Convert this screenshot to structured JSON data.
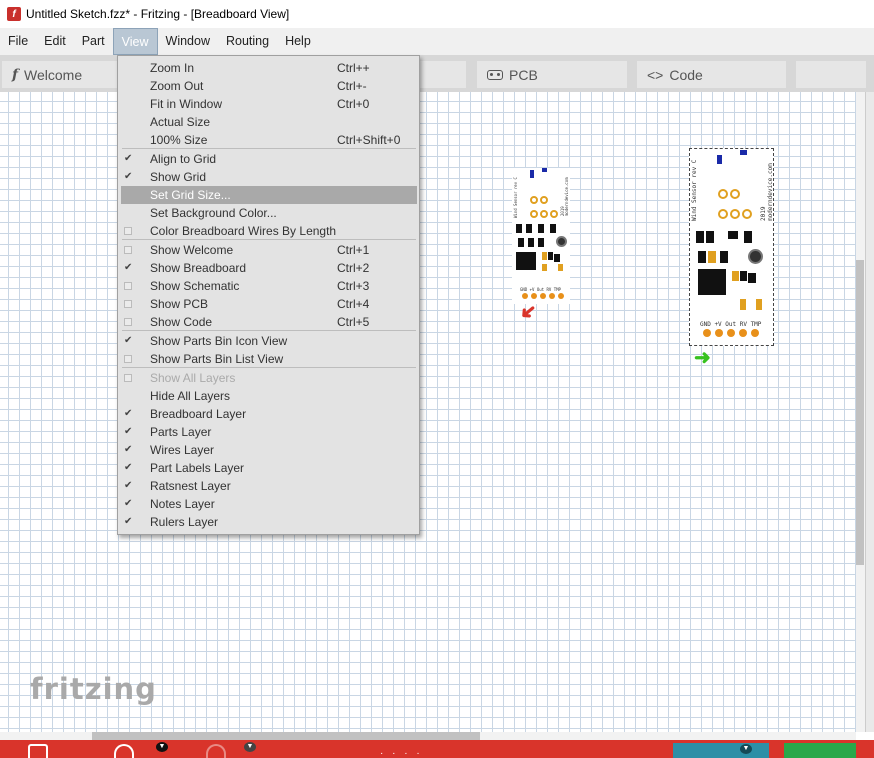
{
  "window": {
    "title": "Untitled Sketch.fzz* - Fritzing - [Breadboard View]",
    "app_icon": "fritzing-f-icon"
  },
  "menubar": {
    "items": [
      {
        "label": "File"
      },
      {
        "label": "Edit"
      },
      {
        "label": "Part"
      },
      {
        "label": "View",
        "active": true
      },
      {
        "label": "Window"
      },
      {
        "label": "Routing"
      },
      {
        "label": "Help"
      }
    ]
  },
  "tabs": {
    "welcome": "Welcome",
    "pcb": "PCB",
    "code": "Code",
    "code_icon": "<>"
  },
  "view_menu": {
    "items": [
      {
        "label": "Zoom In",
        "shortcut": "Ctrl++"
      },
      {
        "label": "Zoom Out",
        "shortcut": "Ctrl+-"
      },
      {
        "label": "Fit in Window",
        "shortcut": "Ctrl+0"
      },
      {
        "label": "Actual Size",
        "shortcut": ""
      },
      {
        "label": "100% Size",
        "shortcut": "Ctrl+Shift+0"
      },
      {
        "label": "Align to Grid",
        "checked": true
      },
      {
        "label": "Show Grid",
        "checked": true
      },
      {
        "label": "Set Grid Size...",
        "highlighted": true
      },
      {
        "label": "Set Background Color..."
      },
      {
        "label": "Color Breadboard Wires By Length",
        "checkable": true,
        "checked": false
      },
      {
        "label": "Show Welcome",
        "shortcut": "Ctrl+1",
        "checkable": true,
        "checked": false
      },
      {
        "label": "Show Breadboard",
        "shortcut": "Ctrl+2",
        "checked": true
      },
      {
        "label": "Show Schematic",
        "shortcut": "Ctrl+3",
        "checkable": true,
        "checked": false
      },
      {
        "label": "Show PCB",
        "shortcut": "Ctrl+4",
        "checkable": true,
        "checked": false
      },
      {
        "label": "Show Code",
        "shortcut": "Ctrl+5",
        "checkable": true,
        "checked": false
      },
      {
        "label": "Show Parts Bin Icon View",
        "checked": true
      },
      {
        "label": "Show Parts Bin List View",
        "checkable": true,
        "checked": false
      },
      {
        "label": "Show All Layers",
        "disabled": true,
        "checkable": true,
        "checked": false
      },
      {
        "label": "Hide All Layers"
      },
      {
        "label": "Breadboard Layer",
        "checked": true
      },
      {
        "label": "Parts Layer",
        "checked": true
      },
      {
        "label": "Wires Layer",
        "checked": true
      },
      {
        "label": "Part Labels Layer",
        "checked": true
      },
      {
        "label": "Ratsnest Layer",
        "checked": true
      },
      {
        "label": "Notes Layer",
        "checked": true
      },
      {
        "label": "Rulers Layer",
        "checked": true
      }
    ]
  },
  "canvas": {
    "logo": "fritzing",
    "part_small": {
      "label": "Wind Sensor rev C",
      "site": "moderndevice.com",
      "year": "2019",
      "pins": "GND +V Out RV TMP"
    },
    "part_big": {
      "label": "Wind Sensor rev C",
      "site": "moderndevice.com",
      "year": "2019",
      "pins": "GND +V Out RV TMP"
    },
    "arrow_red": "➜",
    "arrow_green": "➜",
    "colors": {
      "arrow_red": "#d9342b",
      "arrow_green": "#37c21f",
      "accent_bottom": "#d9342b"
    }
  }
}
